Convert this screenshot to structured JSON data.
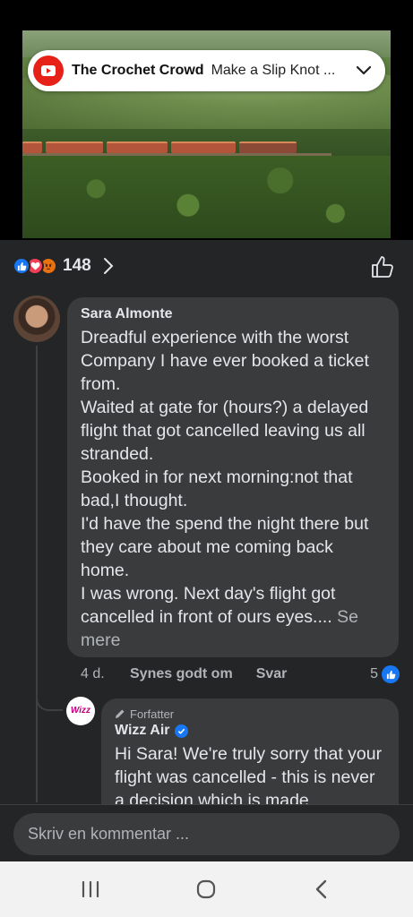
{
  "video": {
    "channel": "The Crochet Crowd",
    "title": "Make a Slip Knot ...",
    "icon": "youtube-icon"
  },
  "reactions": {
    "count": "148",
    "icons": [
      "like-icon",
      "love-icon",
      "angry-icon"
    ]
  },
  "comment": {
    "author": "Sara Almonte",
    "paragraphs": [
      "Dreadful experience with the worst Company I have ever booked a ticket from.",
      "Waited at gate for (hours?) a delayed flight that got cancelled leaving us all stranded.",
      "Booked in for next morning:not that bad,I thought.",
      "I'd have the spend the night there but they care about me coming back home."
    ],
    "last_paragraph": "I was wrong. Next day's flight got cancelled in front of ours eyes....",
    "see_more": "Se mere",
    "time": "4 d.",
    "like_action": "Synes godt om",
    "reply_action": "Svar",
    "like_count": "5"
  },
  "reply": {
    "author_tag": "Forfatter",
    "author": "Wizz Air",
    "avatar_text": "Wizz",
    "text": "Hi Sara! We're truly sorry that your flight was cancelled - this is never a decision which is made"
  },
  "composer": {
    "placeholder": "Skriv en kommentar ..."
  },
  "colors": {
    "panel_bg": "#242526",
    "bubble_bg": "#3a3b3c",
    "accent": "#1877f2"
  }
}
